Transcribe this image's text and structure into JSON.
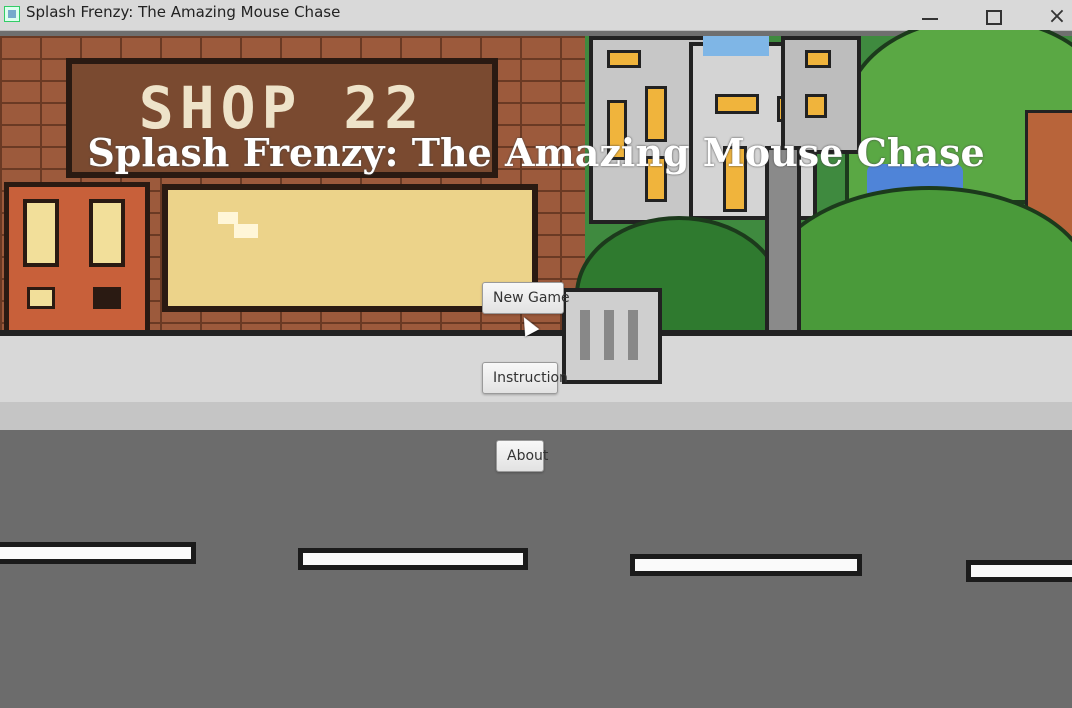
{
  "window": {
    "title": "Splash Frenzy: The Amazing Mouse Chase",
    "close_glyph": "×"
  },
  "scene": {
    "shop_sign": "SHOP 22"
  },
  "menu": {
    "title": "Splash Frenzy: The Amazing Mouse Chase",
    "new_game": "New Game",
    "instruction": "Instruction",
    "about": "About"
  }
}
